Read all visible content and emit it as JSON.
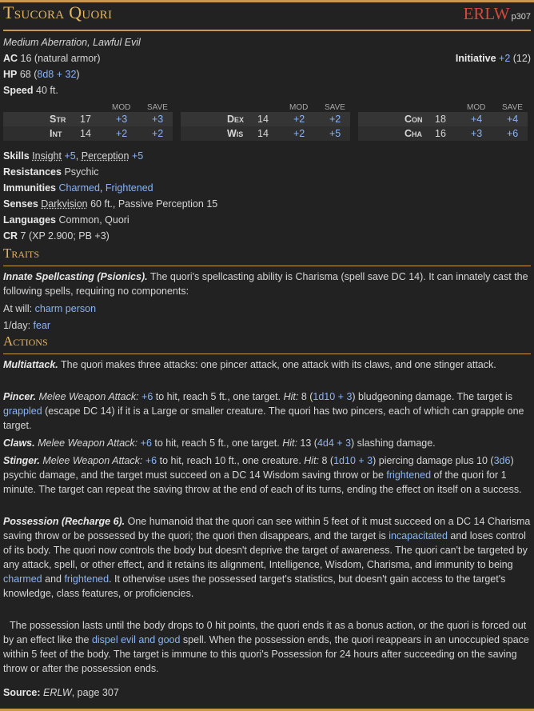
{
  "header": {
    "title": "Tsucora Quori",
    "source_abbr": "ERLW",
    "source_page": "p307"
  },
  "meta": {
    "type_line": "Medium Aberration, Lawful Evil"
  },
  "ac": {
    "label": "AC",
    "value": "16 (natural armor)"
  },
  "initiative": {
    "label": "Initiative",
    "mod": "+2",
    "score": "(12)"
  },
  "hp": {
    "label": "HP",
    "value": "68 (",
    "formula": "8d8 + 32",
    "close": ")"
  },
  "speed": {
    "label": "Speed",
    "value": "40 ft."
  },
  "abilities_header": {
    "mod": "MOD",
    "save": "SAVE"
  },
  "abilities": [
    {
      "name": "Str",
      "score": "17",
      "mod": "+3",
      "save": "+3"
    },
    {
      "name": "Int",
      "score": "14",
      "mod": "+2",
      "save": "+2"
    },
    {
      "name": "Dex",
      "score": "14",
      "mod": "+2",
      "save": "+2"
    },
    {
      "name": "Wis",
      "score": "14",
      "mod": "+2",
      "save": "+5"
    },
    {
      "name": "Con",
      "score": "18",
      "mod": "+4",
      "save": "+4"
    },
    {
      "name": "Cha",
      "score": "16",
      "mod": "+3",
      "save": "+6"
    }
  ],
  "skills": {
    "label": "Skills",
    "s1": "Insight",
    "v1": "+5",
    "sep": ", ",
    "s2": "Perception",
    "v2": "+5"
  },
  "resistances": {
    "label": "Resistances",
    "value": "Psychic"
  },
  "immunities": {
    "label": "Immunities",
    "v1": "Charmed",
    "sep": ", ",
    "v2": "Frightened"
  },
  "senses": {
    "label": "Senses",
    "dark": "Darkvision",
    "rest": " 60 ft., Passive Perception 15"
  },
  "languages": {
    "label": "Languages",
    "value": "Common, Quori"
  },
  "cr": {
    "label": "CR",
    "value": "7 (XP 2.900; PB +3)"
  },
  "traits": {
    "title": "Traits",
    "innate_name": "Innate Spellcasting (Psionics).",
    "innate_text": " The quori's spellcasting ability is Charisma (spell save DC 14). It can innately cast the following spells, requiring no components:",
    "atwill_label": "At will: ",
    "atwill_spell": "charm person",
    "daily_label": "1/day: ",
    "daily_spell": "fear"
  },
  "actions": {
    "title": "Actions",
    "multi_name": "Multiattack.",
    "multi_text": " The quori makes three attacks: one pincer attack, one attack with its claws, and one stinger attack.",
    "pincer": {
      "name": "Pincer.",
      "atk": " Melee Weapon Attack:",
      "bonus": "+6",
      "t1": " to hit, reach 5 ft., one target. ",
      "hit": "Hit:",
      "t2": " 8 (",
      "dice": "1d10 + 3",
      "t3": ") bludgeoning damage. The target is ",
      "cond": "grappled",
      "t4": " (escape DC 14) if it is a Large or smaller creature. The quori has two pincers, each of which can grapple one target."
    },
    "claws": {
      "name": "Claws.",
      "atk": " Melee Weapon Attack:",
      "bonus": "+6",
      "t1": " to hit, reach 5 ft., one target. ",
      "hit": "Hit:",
      "t2": " 13 (",
      "dice": "4d4 + 3",
      "t3": ") slashing damage."
    },
    "stinger": {
      "name": "Stinger.",
      "atk": " Melee Weapon Attack:",
      "bonus": "+6",
      "t1": " to hit, reach 10 ft., one creature. ",
      "hit": "Hit:",
      "t2": " 8 (",
      "dice": "1d10 + 3",
      "t3": ") piercing damage plus 10 (",
      "dice2": "3d6",
      "t4": ") psychic damage, and the target must succeed on a DC 14 Wisdom saving throw or be ",
      "cond": "frightened",
      "t5": " of the quori for 1 minute. The target can repeat the saving throw at the end of each of its turns, ending the effect on itself on a success."
    },
    "possession": {
      "name": "Possession (Recharge ",
      "recharge": "6",
      "name_end": ").",
      "t1": " One humanoid that the quori can see within 5 feet of it must succeed on a DC 14 Charisma saving throw or be possessed by the quori; the quori then disappears, and the target is ",
      "cond1": "incapacitated",
      "t2": " and loses control of its body. The quori now controls the body but doesn't deprive the target of awareness. The quori can't be targeted by any attack, spell, or other effect, and it retains its alignment, Intelligence, Wisdom, Charisma, and immunity to being ",
      "cond2": "charmed",
      "and": " and ",
      "cond3": "frightened",
      "t3": ". It otherwise uses the possessed target's statistics, but doesn't gain access to the target's knowledge, class features, or proficiencies.",
      "p2a": "The possession lasts until the body drops to 0 hit points, the quori ends it as a bonus action, or the quori is forced out by an effect like the ",
      "spell": "dispel evil and good",
      "p2b": " spell. When the possession ends, the quori reappears in an unoccupied space within 5 feet of the body. The target is immune to this quori's Possession for 24 hours after succeeding on the saving throw or after the possession ends."
    }
  },
  "source": {
    "label": "Source:",
    "book": "ERLW",
    "page": ", page 307"
  }
}
